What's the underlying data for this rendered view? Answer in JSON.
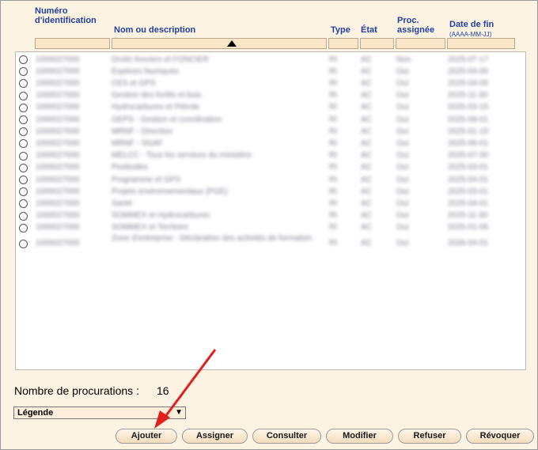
{
  "headers": {
    "id_line1": "Numéro",
    "id_line2": "d'identification",
    "name": "Nom ou description",
    "type": "Type",
    "state": "État",
    "proc_line1": "Proc.",
    "proc_line2": "assignée",
    "date_line1": "Date de fin",
    "date_line2": "(AAAA-MM-JJ)"
  },
  "rows": [
    {
      "id": "1000027000",
      "name": "Droits fonciers et FONCIER",
      "type": "RI",
      "state": "AC",
      "proc": "Non",
      "date": "2025-07-17"
    },
    {
      "id": "1000027000",
      "name": "Espèces fauniques",
      "type": "RI",
      "state": "AC",
      "proc": "Oui",
      "date": "2025-04-05"
    },
    {
      "id": "1000027000",
      "name": "CES et GPS",
      "type": "RI",
      "state": "AC",
      "proc": "Oui",
      "date": "2025-04-05"
    },
    {
      "id": "1000027000",
      "name": "Gestion des forêts et bois",
      "type": "RI",
      "state": "AC",
      "proc": "Oui",
      "date": "2025-11-30"
    },
    {
      "id": "1000027000",
      "name": "Hydrocarbures et Pétrole",
      "type": "RI",
      "state": "AC",
      "proc": "Oui",
      "date": "2025-03-15"
    },
    {
      "id": "1000027000",
      "name": "GEPS - Gestion et coordination",
      "type": "RI",
      "state": "AC",
      "proc": "Oui",
      "date": "2025-08-01"
    },
    {
      "id": "1000027000",
      "name": "MRNF - Direction",
      "type": "RI",
      "state": "AC",
      "proc": "Oui",
      "date": "2025-01-15"
    },
    {
      "id": "1000027000",
      "name": "MRNF - SGAF",
      "type": "RI",
      "state": "AC",
      "proc": "Oui",
      "date": "2025-06-01"
    },
    {
      "id": "1000027000",
      "name": "MELCC - Tous les services du ministère",
      "type": "RI",
      "state": "AC",
      "proc": "Oui",
      "date": "2025-07-30"
    },
    {
      "id": "1000027000",
      "name": "Pesticides",
      "type": "RI",
      "state": "AC",
      "proc": "Oui",
      "date": "2025-03-01"
    },
    {
      "id": "1000027000",
      "name": "Programme et GPS",
      "type": "RI",
      "state": "AC",
      "proc": "Oui",
      "date": "2025-04-01"
    },
    {
      "id": "1000027000",
      "name": "Projets environnementaux (PGE)",
      "type": "RI",
      "state": "AC",
      "proc": "Oui",
      "date": "2025-03-01"
    },
    {
      "id": "1000027000",
      "name": "Santé",
      "type": "RI",
      "state": "AC",
      "proc": "Oui",
      "date": "2025-04-01"
    },
    {
      "id": "1000027000",
      "name": "SOMMEX et Hydrocarbures",
      "type": "RI",
      "state": "AC",
      "proc": "Oui",
      "date": "2025-11-30"
    },
    {
      "id": "1000027000",
      "name": "SOMMEX et Territoire",
      "type": "RI",
      "state": "AC",
      "proc": "Oui",
      "date": "2025-01-05"
    },
    {
      "id": "1000027000",
      "name": "Zone d'entreprise - Déclaration des activités de formation",
      "type": "RI",
      "state": "AC",
      "proc": "Oui",
      "date": "2026-04-01"
    }
  ],
  "footer": {
    "count_label": "Nombre de procurations :",
    "count_value": "16",
    "legend_label": "Légende"
  },
  "buttons": {
    "add": "Ajouter",
    "assign": "Assigner",
    "consult": "Consulter",
    "modify": "Modifier",
    "refuse": "Refuser",
    "revoke": "Révoquer"
  },
  "colors": {
    "header_text": "#1f3fa3",
    "frame_bg": "#fdf3e2",
    "annotation_arrow": "#e02020"
  }
}
